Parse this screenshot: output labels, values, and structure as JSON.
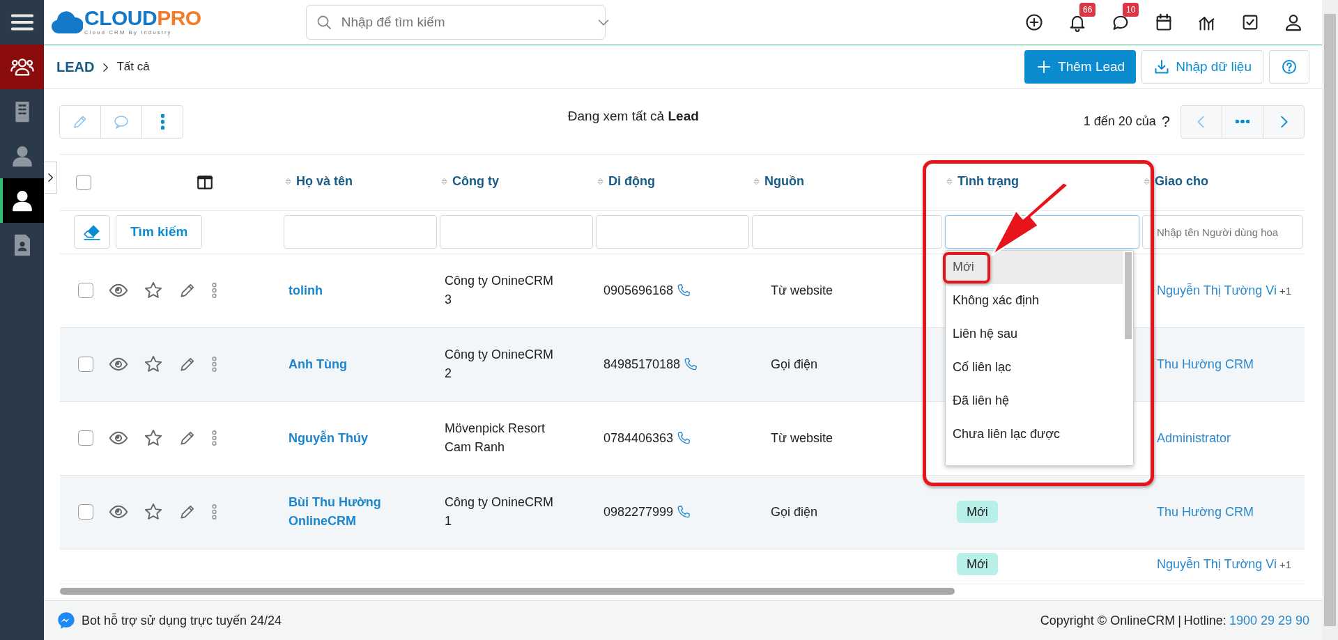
{
  "sidebar": {
    "items": [
      {
        "kind": "menu",
        "selected": false,
        "highlighted": false
      },
      {
        "kind": "people",
        "selected": false,
        "highlighted": true
      },
      {
        "kind": "building",
        "selected": false,
        "highlighted": false
      },
      {
        "kind": "person",
        "selected": false,
        "highlighted": false
      },
      {
        "kind": "person",
        "selected": true,
        "highlighted": false
      },
      {
        "kind": "contact-card",
        "selected": false,
        "highlighted": false
      }
    ]
  },
  "header": {
    "logo": {
      "part_1": "CLOUD",
      "part_2": "PRO",
      "tagline": "Cloud CRM By Industry"
    },
    "search": {
      "placeholder": "Nhập để tìm kiếm"
    },
    "icons": [
      {
        "kind": "plus-circle"
      },
      {
        "kind": "bell",
        "badge": "66"
      },
      {
        "kind": "chat",
        "badge": "10"
      },
      {
        "kind": "calendar"
      },
      {
        "kind": "chart"
      },
      {
        "kind": "checkbox-square"
      },
      {
        "kind": "user"
      }
    ]
  },
  "breadcrumb": {
    "module": "LEAD",
    "current": "Tất cả"
  },
  "actions": [
    {
      "kind": "add",
      "label": "Thêm Lead"
    },
    {
      "kind": "import",
      "label": "Nhập dữ liệu"
    },
    {
      "kind": "help"
    }
  ],
  "toolbar": {
    "tools": [
      {
        "kind": "pencil"
      },
      {
        "kind": "comment"
      },
      {
        "kind": "dots-vertical"
      }
    ],
    "view_text": "Đang xem tất cả **Lead**",
    "range": "1 đến 20 của",
    "total": "?",
    "pager": [
      {
        "kind": "chevron-left"
      },
      {
        "kind": "dots-horizontal"
      },
      {
        "kind": "chevron-right"
      }
    ]
  },
  "table": {
    "columns": [
      {
        "label": "Họ và tên"
      },
      {
        "label": "Công ty"
      },
      {
        "label": "Di động"
      },
      {
        "label": "Nguồn"
      },
      {
        "label": "Tình trạng"
      },
      {
        "label": "Giao cho"
      }
    ],
    "select_all_checked": false,
    "search_button": "Tìm kiếm",
    "filters": [
      {
        "focused": false
      },
      {
        "focused": false
      },
      {
        "focused": false
      },
      {
        "focused": false
      },
      {
        "focused": true,
        "dropdown": {
          "options": [
            {
              "label": "Mới",
              "selected": true
            },
            {
              "label": "Không xác định",
              "selected": false
            },
            {
              "label": "Liên hệ sau",
              "selected": false
            },
            {
              "label": "Cố liên lạc",
              "selected": false
            },
            {
              "label": "Đã liên hệ",
              "selected": false
            },
            {
              "label": "Chưa liên lạc được",
              "selected": false
            }
          ]
        }
      },
      {
        "focused": false,
        "placeholder": "Nhập tên Người dùng hoa"
      }
    ],
    "rows": [
      {
        "checked": false,
        "name": "tolinh",
        "company": "Công ty OnineCRM 3",
        "phone": "0905696168",
        "source": "Từ website",
        "assignee": "Nguyễn Thị Tường Vi",
        "assignee_extra": "+1"
      },
      {
        "checked": false,
        "name": "Anh Tùng",
        "company": "Công ty OnineCRM 2",
        "phone": "84985170188",
        "source": "Gọi điện",
        "assignee": "Thu Hường CRM"
      },
      {
        "checked": false,
        "name": "Nguyễn Thúy",
        "company": "Mövenpick Resort Cam Ranh",
        "phone": "0784406363",
        "source": "Từ website",
        "assignee": "Administrator"
      },
      {
        "checked": false,
        "name": "Bùi Thu Hường OnlineCRM",
        "company": "Công ty OnineCRM 1",
        "phone": "0982277999",
        "source": "Gọi điện",
        "status": "Mới",
        "assignee": "Thu Hường CRM"
      },
      {
        "status": "Mới",
        "assignee": "Nguyễn Thị Tường Vi",
        "assignee_extra": "+1"
      }
    ]
  },
  "footer": {
    "bot_text": "Bot hỗ trợ sử dụng trực tuyến 24/24",
    "copyright": "Copyright © OnlineCRM",
    "separator": "|",
    "hotline_label": "Hotline:",
    "hotline": "1900 29 29 90"
  }
}
